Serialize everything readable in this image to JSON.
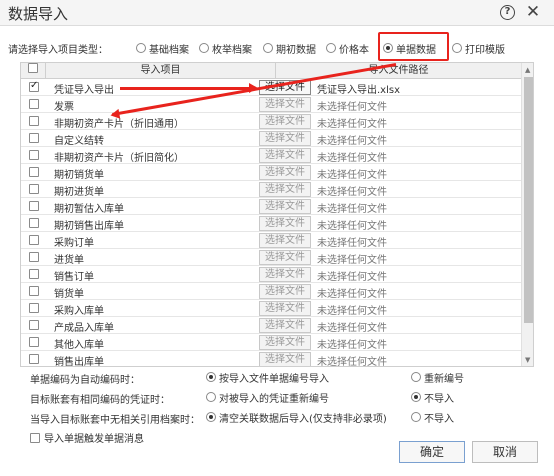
{
  "dialog": {
    "title": "数据导入"
  },
  "import_type": {
    "label": "请选择导入项目类型：",
    "options": [
      {
        "label": "基础档案",
        "selected": false
      },
      {
        "label": "枚举档案",
        "selected": false
      },
      {
        "label": "期初数据",
        "selected": false
      },
      {
        "label": "价格本",
        "selected": false
      },
      {
        "label": "单据数据",
        "selected": true
      },
      {
        "label": "打印模版",
        "selected": false
      }
    ]
  },
  "table": {
    "columns": {
      "item": "导入项目",
      "path": "导入文件路径"
    },
    "button_label": "选择文件",
    "rows": [
      {
        "item": "凭证导入导出",
        "file": "凭证导入导出.xlsx",
        "checked": true,
        "active": true
      },
      {
        "item": "发票",
        "file": "未选择任何文件",
        "checked": false,
        "active": false
      },
      {
        "item": "非期初资产卡片（折旧通用）",
        "file": "未选择任何文件",
        "checked": false,
        "active": false
      },
      {
        "item": "自定义结转",
        "file": "未选择任何文件",
        "checked": false,
        "active": false
      },
      {
        "item": "非期初资产卡片（折旧简化）",
        "file": "未选择任何文件",
        "checked": false,
        "active": false
      },
      {
        "item": "期初销货单",
        "file": "未选择任何文件",
        "checked": false,
        "active": false
      },
      {
        "item": "期初进货单",
        "file": "未选择任何文件",
        "checked": false,
        "active": false
      },
      {
        "item": "期初暂估入库单",
        "file": "未选择任何文件",
        "checked": false,
        "active": false
      },
      {
        "item": "期初销售出库单",
        "file": "未选择任何文件",
        "checked": false,
        "active": false
      },
      {
        "item": "采购订单",
        "file": "未选择任何文件",
        "checked": false,
        "active": false
      },
      {
        "item": "进货单",
        "file": "未选择任何文件",
        "checked": false,
        "active": false
      },
      {
        "item": "销售订单",
        "file": "未选择任何文件",
        "checked": false,
        "active": false
      },
      {
        "item": "销货单",
        "file": "未选择任何文件",
        "checked": false,
        "active": false
      },
      {
        "item": "采购入库单",
        "file": "未选择任何文件",
        "checked": false,
        "active": false
      },
      {
        "item": "产成品入库单",
        "file": "未选择任何文件",
        "checked": false,
        "active": false
      },
      {
        "item": "其他入库单",
        "file": "未选择任何文件",
        "checked": false,
        "active": false
      },
      {
        "item": "销售出库单",
        "file": "未选择任何文件",
        "checked": false,
        "active": false
      }
    ]
  },
  "options": {
    "auto_number": {
      "label": "单据编码为自动编码时：",
      "choices": [
        {
          "label": "按导入文件单据编号导入",
          "selected": true
        },
        {
          "label": "重新编号",
          "selected": false
        }
      ]
    },
    "same_voucher": {
      "label": "目标账套有相同编码的凭证时：",
      "choices": [
        {
          "label": "对被导入的凭证重新编号",
          "selected": false
        },
        {
          "label": "不导入",
          "selected": true
        }
      ]
    },
    "no_reference": {
      "label": "当导入目标账套中无相关引用档案时：",
      "choices": [
        {
          "label": "清空关联数据后导入(仅支持非必录项)",
          "selected": true
        },
        {
          "label": "不导入",
          "selected": false
        }
      ]
    }
  },
  "trigger_message": {
    "label": "导入单据触发单据消息",
    "checked": false
  },
  "buttons": {
    "ok": "确定",
    "cancel": "取消"
  },
  "colors": {
    "annotation": "#e8231d"
  }
}
